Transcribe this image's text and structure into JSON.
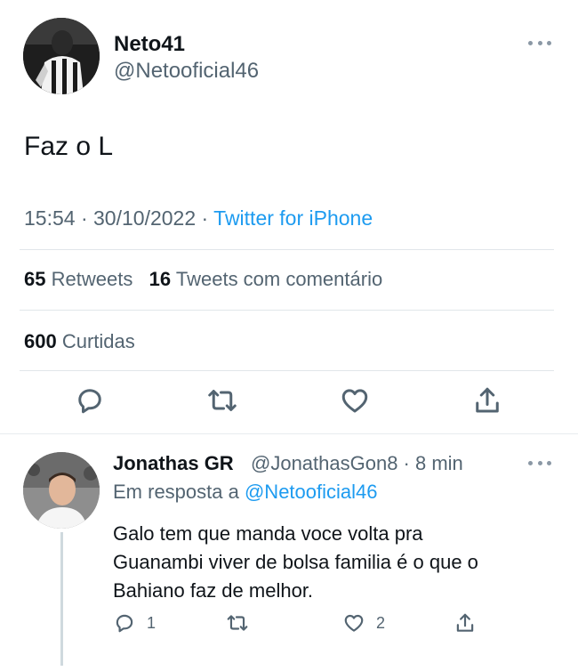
{
  "tweet": {
    "author_name": "Neto41",
    "author_handle": "@Netooficial46",
    "text": "Faz o L",
    "time": "15:54",
    "date": "30/10/2022",
    "source": "Twitter for iPhone",
    "stats": {
      "retweets_count": "65",
      "retweets_label": "Retweets",
      "quotes_count": "16",
      "quotes_label": "Tweets com comentário",
      "likes_count": "600",
      "likes_label": "Curtidas"
    },
    "actions": [
      "reply-icon",
      "retweet-icon",
      "like-icon",
      "share-icon"
    ]
  },
  "reply": {
    "author_name": "Jonathas GR",
    "author_handle": "@JonathasGon8 · 8 min",
    "in_reply_prefix": "Em resposta a",
    "in_reply_mention": "@Netooficial46",
    "text_lines": [
      "Galo tem que manda voce volta pra",
      "Guanambi viver de bolsa familia é o que o",
      "Bahiano faz de melhor."
    ],
    "reply_count": "1",
    "like_count": "2"
  },
  "colors": {
    "text": "#0f1419",
    "secondary": "#536471",
    "accent": "#1d9bf0",
    "divider": "#e1e6ea",
    "icon": "#536471"
  }
}
